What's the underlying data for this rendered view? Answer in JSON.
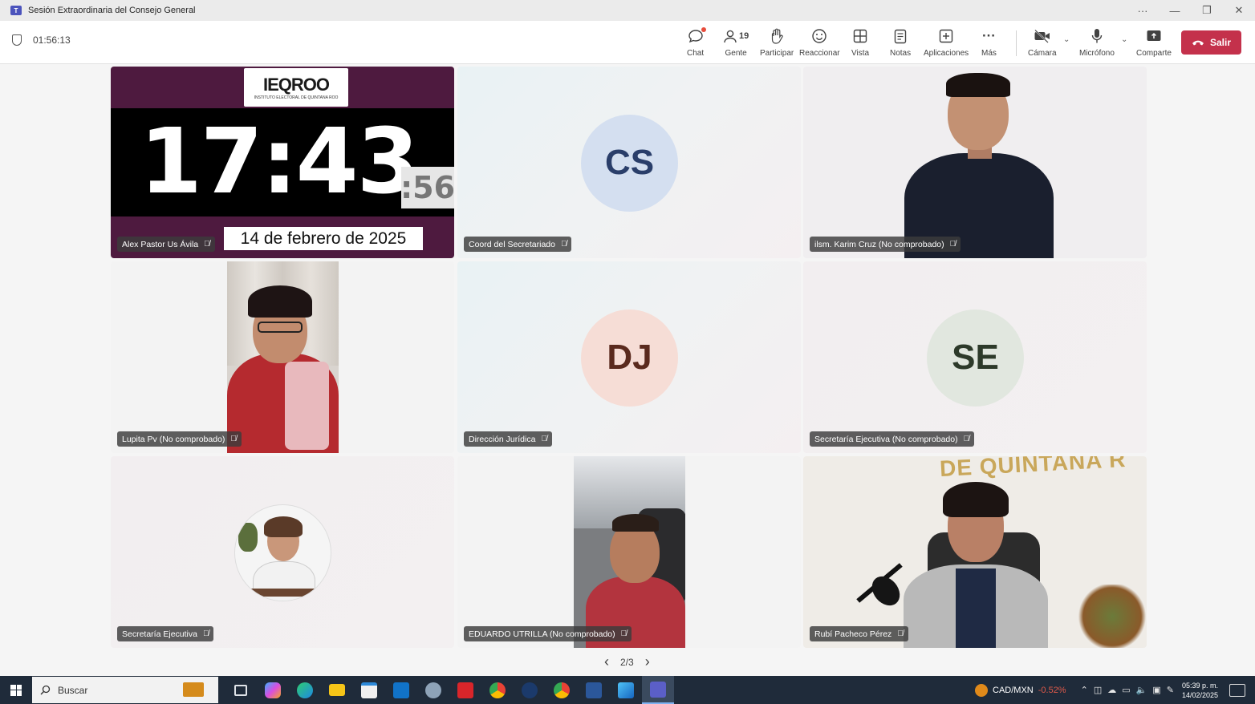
{
  "window": {
    "title": "Sesión Extraordinaria del Consejo General",
    "app_icon": "teams-icon",
    "controls": [
      "···",
      "—",
      "❐",
      "✕"
    ]
  },
  "meeting": {
    "elapsed": "01:56:13",
    "chat_label": "Chat",
    "people_label": "Gente",
    "people_count": "19",
    "raise_label": "Participar",
    "react_label": "Reaccionar",
    "view_label": "Vista",
    "notes_label": "Notas",
    "apps_label": "Aplicaciones",
    "more_label": "Más",
    "camera_label": "Cámara",
    "mic_label": "Micrófono",
    "share_label": "Comparte",
    "leave_label": "Salir"
  },
  "clock_tile": {
    "logo": "IEQROO",
    "logo_sub": "INSTITUTO ELECTORAL DE QUINTANA ROO",
    "time": "17:43",
    "seconds": ":56",
    "date": "14 de febrero de 2025",
    "name": "Alex Pastor Us Ávila"
  },
  "participants": [
    {
      "name": "Coord del Secretariado",
      "initials": "CS"
    },
    {
      "name": "ilsm. Karim Cruz (No comprobado)"
    },
    {
      "name": "Lupita Pv (No comprobado)"
    },
    {
      "name": "Dirección Jurídica",
      "initials": "DJ"
    },
    {
      "name": "Secretaría Ejecutiva (No comprobado)",
      "initials": "SE"
    },
    {
      "name": "Secretaría Ejecutiva"
    },
    {
      "name": "EDUARDO UTRILLA (No comprobado)"
    },
    {
      "name": "Rubí Pacheco Pérez"
    }
  ],
  "background_text": "DE QUINTANA R",
  "pager": {
    "prev": "‹",
    "page": "2/3",
    "next": "›"
  },
  "taskbar": {
    "search_label": "Buscar",
    "ticker_symbol": "CAD/MXN",
    "ticker_change": "-0.52%",
    "time": "05:39 p. m.",
    "date": "14/02/2025"
  },
  "colors": {
    "leave": "#c4314b",
    "clock_bg": "#4e1a3f",
    "taskbar": "#1f2b3a"
  }
}
